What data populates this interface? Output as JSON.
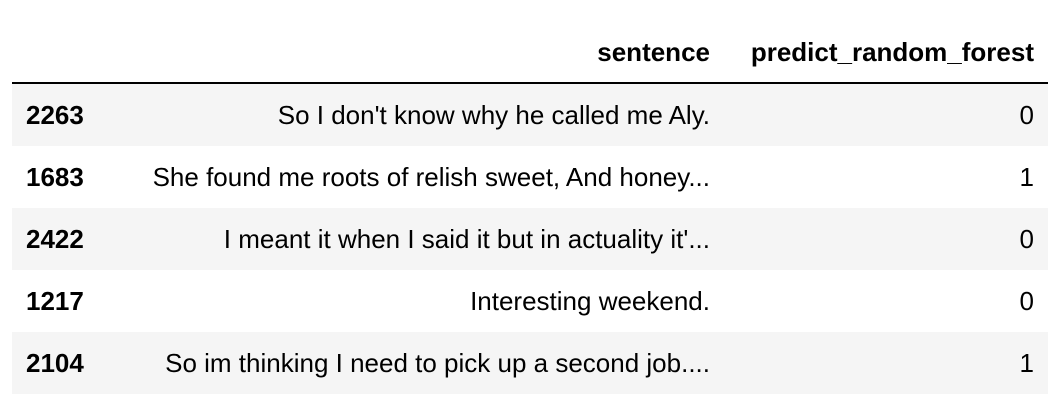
{
  "table": {
    "index_header": "",
    "columns": [
      "sentence",
      "predict_random_forest"
    ],
    "rows": [
      {
        "index": "2263",
        "sentence": "So I don't know why he called me Aly.",
        "predict_random_forest": "0"
      },
      {
        "index": "1683",
        "sentence": "She found me roots of relish sweet, And honey...",
        "predict_random_forest": "1"
      },
      {
        "index": "2422",
        "sentence": "I meant it when I said it but in actuality it'...",
        "predict_random_forest": "0"
      },
      {
        "index": "1217",
        "sentence": "Interesting weekend.",
        "predict_random_forest": "0"
      },
      {
        "index": "2104",
        "sentence": "So im thinking I need to pick up a second job....",
        "predict_random_forest": "1"
      }
    ]
  },
  "colors": {
    "striped_row": "#f5f5f5",
    "header_rule": "#000000"
  }
}
